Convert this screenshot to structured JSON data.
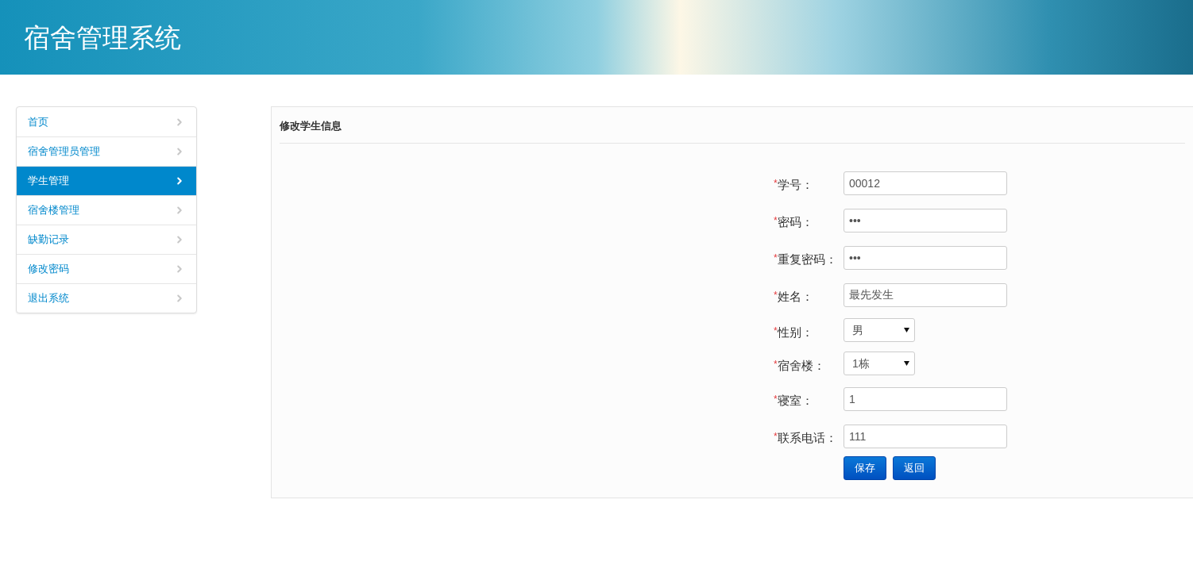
{
  "header": {
    "title": "宿舍管理系统"
  },
  "sidebar": {
    "items": [
      {
        "label": "首页",
        "selected": false
      },
      {
        "label": "宿舍管理员管理",
        "selected": false
      },
      {
        "label": "学生管理",
        "selected": true
      },
      {
        "label": "宿舍楼管理",
        "selected": false
      },
      {
        "label": "缺勤记录",
        "selected": false
      },
      {
        "label": "修改密码",
        "selected": false
      },
      {
        "label": "退出系统",
        "selected": false
      }
    ]
  },
  "panel": {
    "title": "修改学生信息",
    "fields": [
      {
        "mark": "*",
        "label": "学号：",
        "kind": "text",
        "value": "00012"
      },
      {
        "mark": "*",
        "label": "密码：",
        "kind": "text",
        "value": "•••"
      },
      {
        "mark": "*",
        "label": "重复密码：",
        "kind": "text",
        "value": "•••"
      },
      {
        "mark": "*",
        "label": "姓名：",
        "kind": "text",
        "value": "最先发生"
      },
      {
        "mark": "*",
        "label": "性别：",
        "kind": "select",
        "value": "男"
      },
      {
        "mark": "*",
        "label": "宿舍楼：",
        "kind": "select",
        "value": "1栋"
      },
      {
        "mark": "*",
        "label": "寝室：",
        "kind": "text",
        "value": "1"
      },
      {
        "mark": "*",
        "label": "联系电话：",
        "kind": "text",
        "value": "111"
      }
    ],
    "buttons": [
      "保存",
      "返回"
    ]
  }
}
